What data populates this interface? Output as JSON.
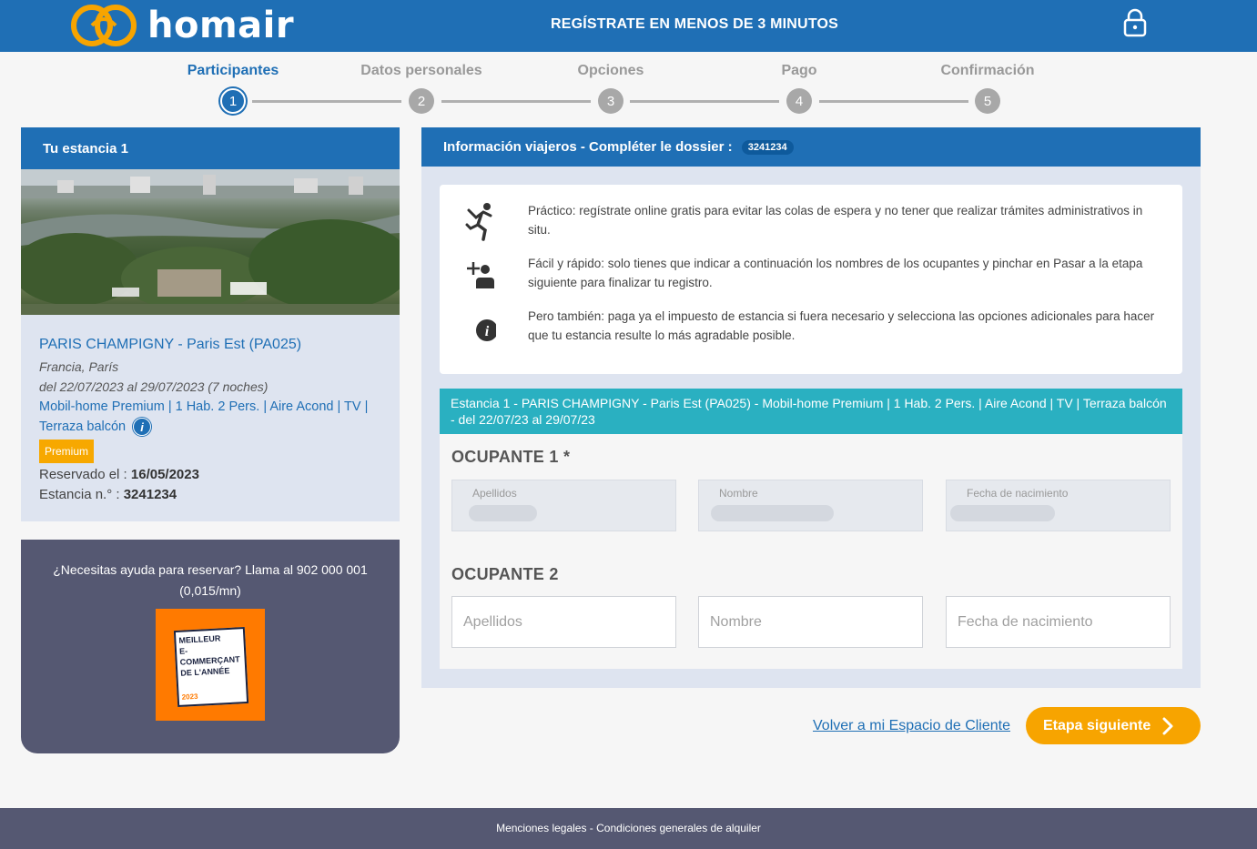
{
  "header": {
    "logo_text": "homair",
    "title": "REGÍSTRATE EN MENOS DE 3 MINUTOS",
    "brand_color": "#1f6fb5"
  },
  "steps": [
    {
      "label": "Participantes",
      "number": "1",
      "active": true
    },
    {
      "label": "Datos personales",
      "number": "2",
      "active": false
    },
    {
      "label": "Opciones",
      "number": "3",
      "active": false
    },
    {
      "label": "Pago",
      "number": "4",
      "active": false
    },
    {
      "label": "Confirmación",
      "number": "5",
      "active": false
    }
  ],
  "stay": {
    "heading": "Tu estancia 1",
    "camp_name": "PARIS CHAMPIGNY - Paris Est (PA025)",
    "location": "Francia, París",
    "dates": "del 22/07/2023 al 29/07/2023 (7 noches)",
    "accommodation": "Mobil-home Premium | 1 Hab. 2 Pers. | Aire Acond | TV | Terraza balcón",
    "badge": "Premium",
    "booked_label": "Reservado el : ",
    "booked_value": "16/05/2023",
    "stay_no_label": "Estancia n.° : ",
    "stay_no_value": "3241234"
  },
  "help": {
    "text": "¿Necesitas ayuda para reservar? Llama al 902 000 001 (0,015/mn)",
    "award_line1": "MEILLEUR",
    "award_line2": "E-COMMERÇANT",
    "award_line3": "DE L'ANNÉE",
    "award_year": "2023"
  },
  "main": {
    "heading": "Información viajeros - Compléter le dossier :",
    "dossier_no": "3241234",
    "info": [
      {
        "icon": "runner-icon",
        "text": "Práctico: regístrate online gratis para evitar las colas de espera y no tener que realizar trámites administrativos in situ."
      },
      {
        "icon": "add-person-icon",
        "text": "Fácil y rápido: solo tienes que indicar a continuación los nombres de los ocupantes y pinchar en Pasar a la etapa siguiente para finalizar tu registro."
      },
      {
        "icon": "info-icon",
        "text": "Pero también: paga ya el impuesto de estancia si fuera necesario y selecciona las opciones adicionales para hacer que tu estancia resulte lo más agradable posible."
      }
    ],
    "stay_bar": "Estancia 1 - PARIS CHAMPIGNY - Paris Est (PA025) - Mobil-home Premium | 1 Hab. 2 Pers. | Aire Acond | TV | Terraza balcón - del 22/07/23 al 29/07/23",
    "occupant1": {
      "title": "OCUPANTE 1 *",
      "lastname_label": "Apellidos",
      "firstname_label": "Nombre",
      "birthdate_label": "Fecha de nacimiento"
    },
    "occupant2": {
      "title": "OCUPANTE 2",
      "lastname_placeholder": "Apellidos",
      "firstname_placeholder": "Nombre",
      "birthdate_placeholder": "Fecha de nacimiento",
      "lastname_value": "",
      "firstname_value": "",
      "birthdate_value": ""
    }
  },
  "actions": {
    "back_link": "Volver a mi Espacio de Cliente",
    "next_button": "Etapa siguiente",
    "accent_color": "#f7a400"
  },
  "footer": {
    "text": "Menciones legales - Condiciones generales de alquiler"
  }
}
